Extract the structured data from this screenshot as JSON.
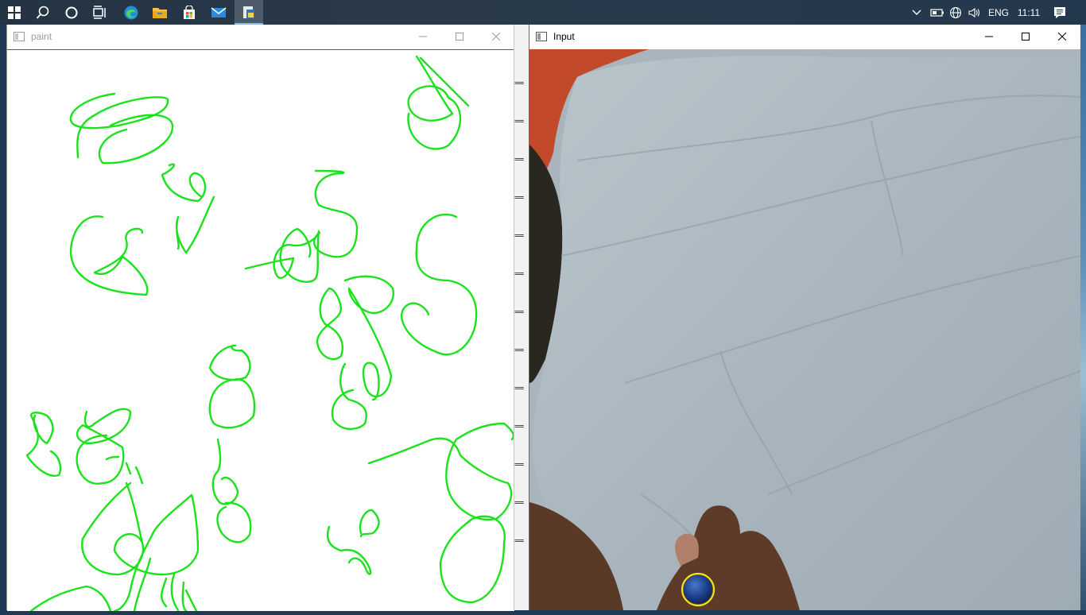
{
  "taskbar": {
    "icons": [
      "windows-start-icon",
      "search-icon",
      "cortana-icon",
      "task-view-icon",
      "edge-icon",
      "file-explorer-icon",
      "store-icon",
      "mail-icon",
      "python-icon"
    ],
    "tray": {
      "language": "ENG",
      "time": "11:11"
    }
  },
  "paint_window": {
    "title": "paint"
  },
  "input_window": {
    "title": "Input"
  },
  "gap_marks": [
    "==",
    "==",
    "==",
    "==",
    "==",
    "==",
    "==",
    "==",
    "==",
    "==",
    "==",
    "==",
    "=="
  ],
  "colors": {
    "stroke": "#1be31b",
    "marker_ring": "#f0e61a",
    "marker_fill": "#1a3f8a"
  }
}
